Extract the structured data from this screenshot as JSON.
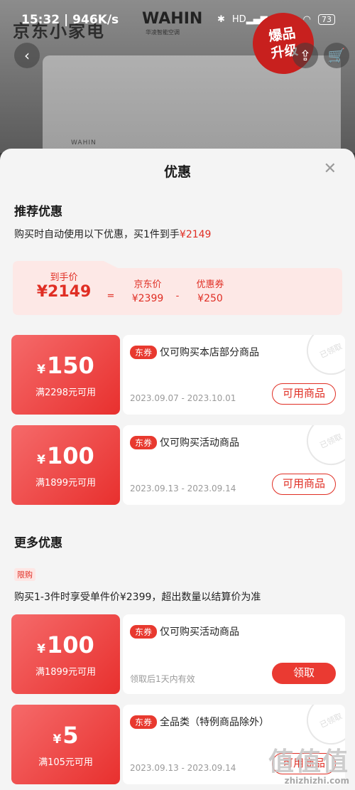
{
  "statusbar": {
    "time": "15:32",
    "speed": "946K/s",
    "network": "HD",
    "battery": "73"
  },
  "header": {
    "logo_text": "京东小家电",
    "brand2": "WAHIN",
    "brand2_sub": "华凌智能空调",
    "hot_badge_line1": "爆品",
    "hot_badge_line2": "升级",
    "unit_brand": "WAHIN"
  },
  "sheet": {
    "title": "优惠",
    "recommend_title": "推荐优惠",
    "recommend_line_prefix": "购买时自动使用以下优惠，买1件到手",
    "recommend_line_price": "¥2149",
    "calc": {
      "final_label": "到手价",
      "final_value": "¥2149",
      "eq": "=",
      "jd_label": "京东价",
      "jd_value": "¥2399",
      "minus": "-",
      "coupon_label": "优惠券",
      "coupon_value": "¥250"
    },
    "more_title": "更多优惠",
    "limit_tag": "限购",
    "limit_line": "购买1-3件时享受单件价¥2399，超出数量以结算价为准"
  },
  "coupons": [
    {
      "yen": "¥",
      "amount": "150",
      "condition": "满2298元可用",
      "tag": "东券",
      "desc": "仅可购买本店部分商品",
      "date": "2023.09.07 - 2023.10.01",
      "button": "可用商品",
      "stamp": "已领取"
    },
    {
      "yen": "¥",
      "amount": "100",
      "condition": "满1899元可用",
      "tag": "东券",
      "desc": "仅可购买活动商品",
      "date": "2023.09.13 - 2023.09.14",
      "button": "可用商品",
      "stamp": "已领取"
    },
    {
      "yen": "¥",
      "amount": "100",
      "condition": "满1899元可用",
      "tag": "东券",
      "desc": "仅可购买活动商品",
      "date": "领取后1天内有效",
      "button": "领取"
    },
    {
      "yen": "¥",
      "amount": "5",
      "condition": "满105元可用",
      "tag": "东券",
      "desc": "全品类（特例商品除外）",
      "date": "2023.09.13 - 2023.09.14",
      "button": "可用商品",
      "stamp": "已领取"
    }
  ],
  "watermark": {
    "big": "值值值",
    "small": "zhizhizhi.com"
  },
  "colors": {
    "accent": "#e02e24",
    "coupon_gradient_start": "#f56a6a",
    "coupon_gradient_end": "#e8302e"
  }
}
